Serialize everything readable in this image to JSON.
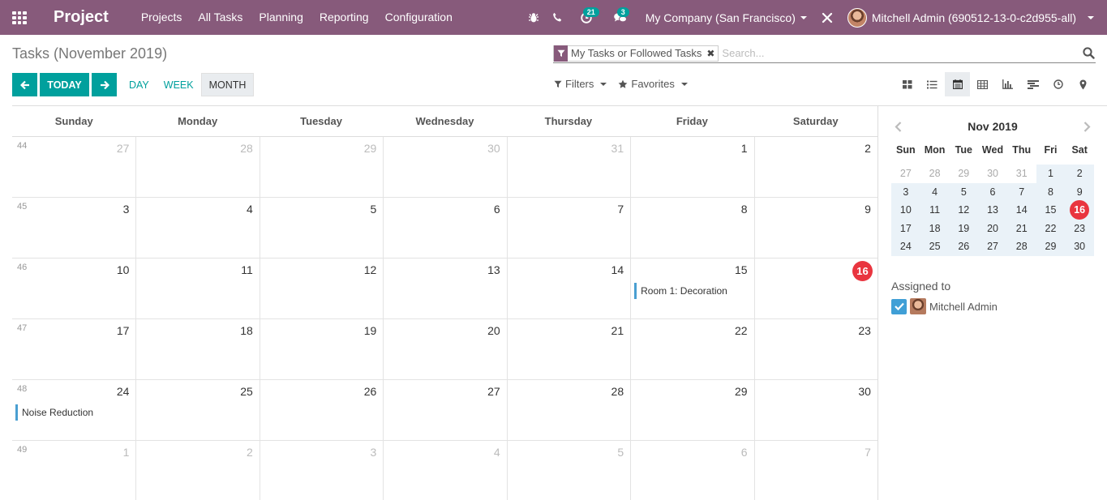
{
  "navbar": {
    "brand": "Project",
    "menu": [
      "Projects",
      "All Tasks",
      "Planning",
      "Reporting",
      "Configuration"
    ],
    "activity_badge": "21",
    "messages_badge": "3",
    "company": "My Company (San Francisco)",
    "user": "Mitchell Admin (690512-13-0-c2d955-all)"
  },
  "control": {
    "breadcrumb": "Tasks (November 2019)",
    "facet": "My Tasks or Followed Tasks",
    "search_placeholder": "Search...",
    "today_label": "TODAY",
    "day_label": "DAY",
    "week_label": "WEEK",
    "month_label": "MONTH",
    "filters_label": "Filters",
    "favorites_label": "Favorites"
  },
  "calendar": {
    "day_headers": [
      "Sunday",
      "Monday",
      "Tuesday",
      "Wednesday",
      "Thursday",
      "Friday",
      "Saturday"
    ],
    "weeks": [
      {
        "num": "44",
        "days": [
          {
            "d": "27",
            "o": true
          },
          {
            "d": "28",
            "o": true
          },
          {
            "d": "29",
            "o": true
          },
          {
            "d": "30",
            "o": true
          },
          {
            "d": "31",
            "o": true
          },
          {
            "d": "1"
          },
          {
            "d": "2"
          }
        ]
      },
      {
        "num": "45",
        "days": [
          {
            "d": "3"
          },
          {
            "d": "4"
          },
          {
            "d": "5"
          },
          {
            "d": "6"
          },
          {
            "d": "7"
          },
          {
            "d": "8"
          },
          {
            "d": "9"
          }
        ]
      },
      {
        "num": "46",
        "days": [
          {
            "d": "10"
          },
          {
            "d": "11"
          },
          {
            "d": "12"
          },
          {
            "d": "13"
          },
          {
            "d": "14"
          },
          {
            "d": "15",
            "event": "Room 1: Decoration"
          },
          {
            "d": "16",
            "today": true
          }
        ]
      },
      {
        "num": "47",
        "days": [
          {
            "d": "17"
          },
          {
            "d": "18"
          },
          {
            "d": "19"
          },
          {
            "d": "20"
          },
          {
            "d": "21"
          },
          {
            "d": "22"
          },
          {
            "d": "23"
          }
        ]
      },
      {
        "num": "48",
        "days": [
          {
            "d": "24",
            "event": "Noise Reduction"
          },
          {
            "d": "25"
          },
          {
            "d": "26"
          },
          {
            "d": "27"
          },
          {
            "d": "28"
          },
          {
            "d": "29"
          },
          {
            "d": "30"
          }
        ]
      },
      {
        "num": "49",
        "days": [
          {
            "d": "1",
            "o": true
          },
          {
            "d": "2",
            "o": true
          },
          {
            "d": "3",
            "o": true
          },
          {
            "d": "4",
            "o": true
          },
          {
            "d": "5",
            "o": true
          },
          {
            "d": "6",
            "o": true
          },
          {
            "d": "7",
            "o": true
          }
        ]
      }
    ]
  },
  "sidebar": {
    "mini_title": "Nov 2019",
    "dow": [
      "Sun",
      "Mon",
      "Tue",
      "Wed",
      "Thu",
      "Fri",
      "Sat"
    ],
    "mini_weeks": [
      [
        {
          "d": "27",
          "o": true
        },
        {
          "d": "28",
          "o": true
        },
        {
          "d": "29",
          "o": true
        },
        {
          "d": "30",
          "o": true
        },
        {
          "d": "31",
          "o": true
        },
        {
          "d": "1"
        },
        {
          "d": "2"
        }
      ],
      [
        {
          "d": "3"
        },
        {
          "d": "4"
        },
        {
          "d": "5"
        },
        {
          "d": "6"
        },
        {
          "d": "7"
        },
        {
          "d": "8"
        },
        {
          "d": "9"
        }
      ],
      [
        {
          "d": "10"
        },
        {
          "d": "11"
        },
        {
          "d": "12"
        },
        {
          "d": "13"
        },
        {
          "d": "14"
        },
        {
          "d": "15"
        },
        {
          "d": "16",
          "today": true
        }
      ],
      [
        {
          "d": "17"
        },
        {
          "d": "18"
        },
        {
          "d": "19"
        },
        {
          "d": "20"
        },
        {
          "d": "21"
        },
        {
          "d": "22"
        },
        {
          "d": "23"
        }
      ],
      [
        {
          "d": "24"
        },
        {
          "d": "25"
        },
        {
          "d": "26"
        },
        {
          "d": "27"
        },
        {
          "d": "28"
        },
        {
          "d": "29"
        },
        {
          "d": "30"
        }
      ]
    ],
    "assigned_title": "Assigned to",
    "assignee": "Mitchell Admin"
  },
  "colors": {
    "brand": "#875a7b",
    "primary": "#00a09d",
    "today": "#e9353f",
    "event": "#4a9fd1"
  }
}
